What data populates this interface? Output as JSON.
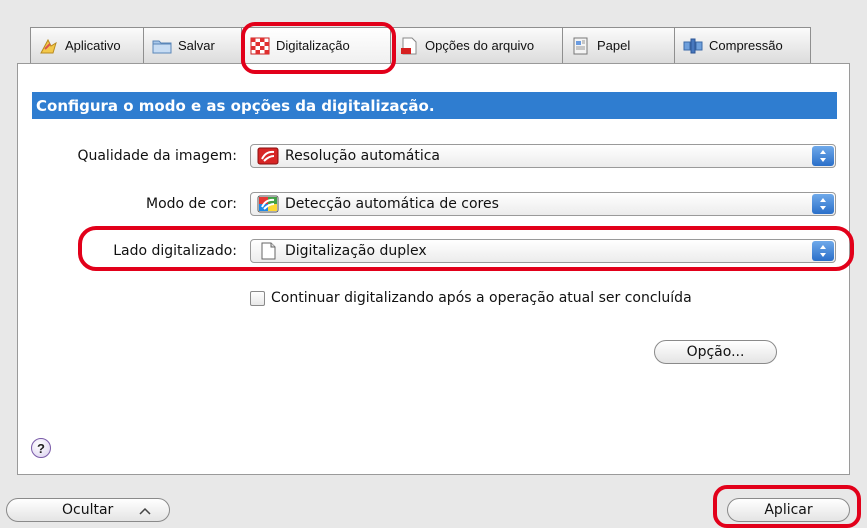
{
  "tabs": [
    {
      "label": "Aplicativo",
      "icon": "application-icon"
    },
    {
      "label": "Salvar",
      "icon": "folder-icon"
    },
    {
      "label": "Digitalização",
      "icon": "checkerboard-scan-icon",
      "active": true
    },
    {
      "label": "Opções do arquivo",
      "icon": "pdf-file-icon"
    },
    {
      "label": "Papel",
      "icon": "paper-icon"
    },
    {
      "label": "Compressão",
      "icon": "compression-icon"
    }
  ],
  "panel": {
    "header": "Configura o modo e as opções da digitalização.",
    "image_quality": {
      "label": "Qualidade da imagem:",
      "value": "Resolução automática"
    },
    "color_mode": {
      "label": "Modo de cor:",
      "value": "Detecção automática de cores"
    },
    "scan_side": {
      "label": "Lado digitalizado:",
      "value": "Digitalização duplex"
    },
    "continue_checkbox": {
      "label": "Continuar digitalizando após a operação atual ser concluída",
      "checked": false
    },
    "option_button": "Opção...",
    "help": "?"
  },
  "footer": {
    "hide_button": "Ocultar",
    "apply_button": "Aplicar"
  },
  "colors": {
    "header_bg": "#2f7dd0",
    "highlight": "#e2001a",
    "stepper": "#2a6fc9"
  }
}
